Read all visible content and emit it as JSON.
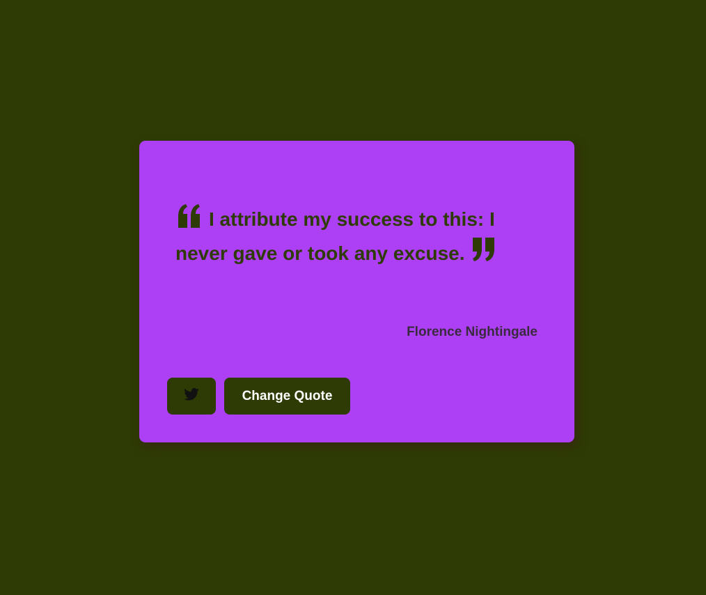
{
  "quote": {
    "text": "I attribute my success to this: I never gave or took any excuse.",
    "author": "Florence Nightingale",
    "open_mark_icon": "quote-left-icon",
    "close_mark_icon": "quote-right-icon"
  },
  "actions": {
    "tweet_icon": "twitter-icon",
    "change_quote_label": "Change Quote"
  },
  "colors": {
    "background": "#2e3b04",
    "card": "#ad40f4",
    "button": "#2e3b04",
    "button_text": "#ffffff"
  }
}
